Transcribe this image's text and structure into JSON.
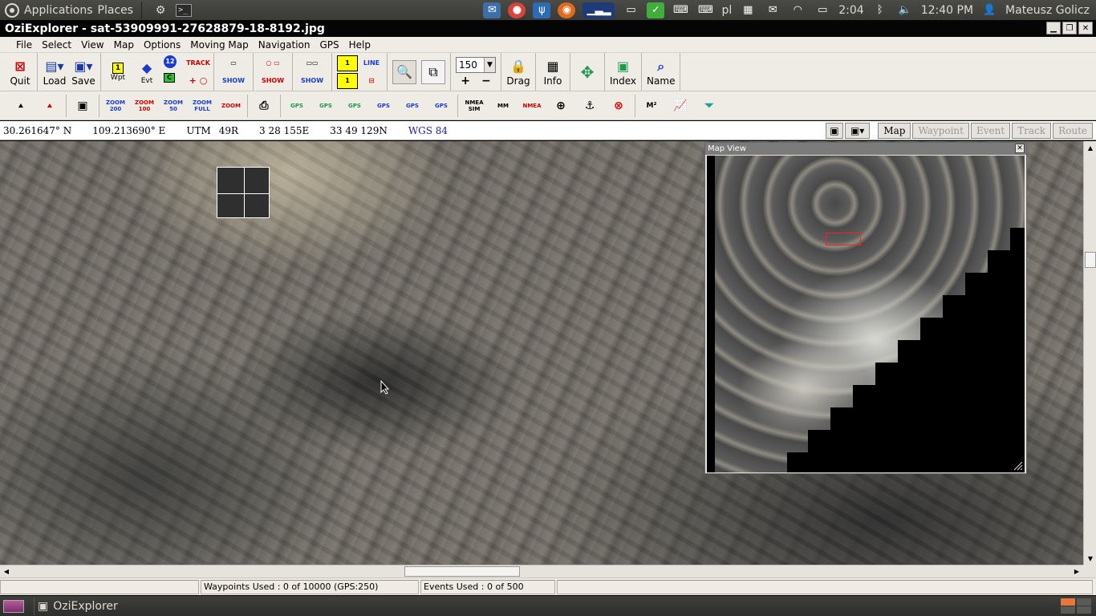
{
  "top_panel": {
    "applications": "Applications",
    "places": "Places",
    "battery": "2:04",
    "keyboard_layout": "pl",
    "clock": "12:40 PM",
    "user": "Mateusz Golicz"
  },
  "window": {
    "title": "OziExplorer - sat-53909991-27628879-18-8192.jpg"
  },
  "menu": [
    "File",
    "Select",
    "View",
    "Map",
    "Options",
    "Moving Map",
    "Navigation",
    "GPS",
    "Help"
  ],
  "toolbar1": {
    "quit": "Quit",
    "load": "Load",
    "save": "Save",
    "wpt": "Wpt",
    "evt": "Evt",
    "track": "TRACK",
    "show1": "SHOW",
    "show2": "SHOW",
    "show3": "SHOW",
    "line": "LINE",
    "zoom_value": "150",
    "drag": "Drag",
    "info": "Info",
    "index": "Index",
    "name": "Name"
  },
  "toolbar2": {
    "zoom200": "ZOOM 200",
    "zoom100": "ZOOM 100",
    "zoom50": "ZOOM 50",
    "zoomfull": "ZOOM FULL",
    "zoom": "ZOOM",
    "gps1": "GPS",
    "gps2": "GPS",
    "gps3": "GPS",
    "gps4": "GPS",
    "gps5": "GPS",
    "gps6": "GPS",
    "nmea_sim": "NMEA SIM",
    "mm": "MM",
    "nmea": "NMEA",
    "m2": "M²"
  },
  "coords": {
    "lat": "30.261647° N",
    "lon": "109.213690° E",
    "utm": "UTM",
    "zone": "49R",
    "easting": "3 28 155E",
    "northing": "33 49 129N",
    "datum": "WGS 84"
  },
  "mode_tabs": {
    "map": "Map",
    "waypoint": "Waypoint",
    "event": "Event",
    "track": "Track",
    "route": "Route"
  },
  "map_view": {
    "title": "Map View"
  },
  "status": {
    "waypoints": "Waypoints Used : 0 of 10000  (GPS:250)",
    "events": "Events Used : 0 of 500"
  },
  "taskbar": {
    "app": "OziExplorer"
  },
  "colors": {
    "accent_orange": "#e9763a",
    "datum_blue": "#1a1a9a",
    "view_rect_red": "#ff2020"
  }
}
